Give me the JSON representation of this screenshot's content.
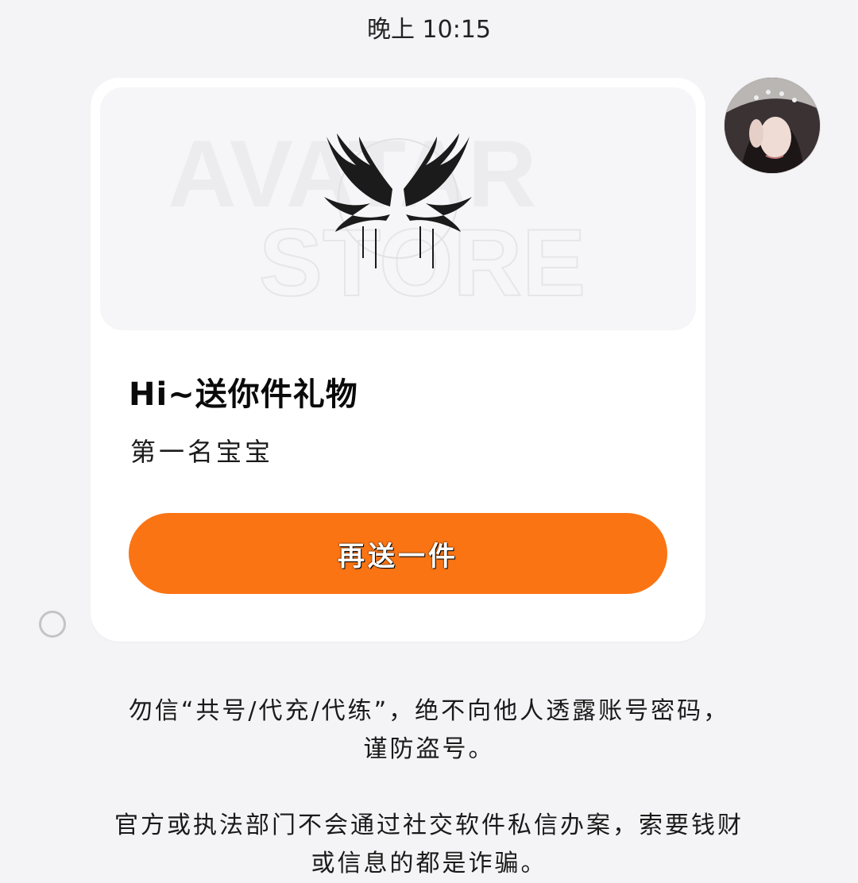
{
  "timestamp": "晚上 10:15",
  "gift_card": {
    "banner_watermark": [
      "AVATAR",
      "STORE"
    ],
    "title": "Hi~送你件礼物",
    "subtitle": "第一名宝宝",
    "button_label": "再送一件",
    "button_color": "#fb7414"
  },
  "notices": [
    {
      "line1": "勿信“共号/代充/代练”，绝不向他人透露账号密码，",
      "line2": "谨防盗号。"
    },
    {
      "line1": "官方或执法部门不会通过社交软件私信办案，索要钱财",
      "line2": "或信息的都是诈骗。"
    }
  ],
  "icons": {
    "avatar": "user-avatar",
    "select": "select-circle-icon",
    "banner": "wings-icon"
  }
}
